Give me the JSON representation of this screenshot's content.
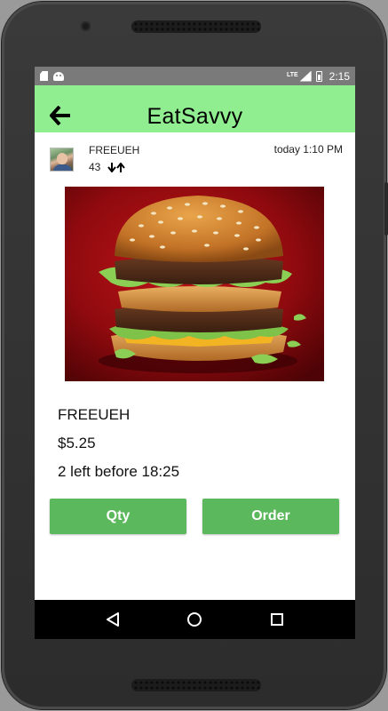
{
  "status_bar": {
    "time": "2:15",
    "network_label": "LTE",
    "icons": [
      "sd-card-icon",
      "android-icon",
      "signal-icon",
      "battery-icon"
    ]
  },
  "app_bar": {
    "title": "EatSavvy",
    "background_color": "#90ee90",
    "back_icon": "arrow-left-icon"
  },
  "post": {
    "username": "FREEUEH",
    "vote_count": "43",
    "timestamp": "today 1:10 PM",
    "image_subject": "double cheeseburger with sesame seed bun on red background"
  },
  "item": {
    "name": "FREEUEH",
    "price": "$5.25",
    "availability": "2 left before 18:25"
  },
  "actions": {
    "qty_label": "Qty",
    "order_label": "Order",
    "button_color": "#5cb85c"
  },
  "nav_bar": {
    "icons": [
      "back-triangle-icon",
      "home-circle-icon",
      "recents-square-icon"
    ]
  }
}
